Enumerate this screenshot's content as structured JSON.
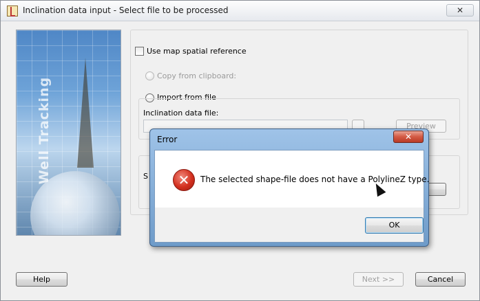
{
  "window": {
    "title": "Inclination data input - Select file to be processed",
    "close_glyph": "✕"
  },
  "sidebar": {
    "brand_text": "Well Tracking"
  },
  "options": {
    "use_map_spatial_reference": "Use map spatial reference",
    "copy_from_clipboard": "Copy from clipboard:",
    "import_from_file": "Import from file",
    "inclination_data_file_label": "Inclination data file:",
    "preview_label": "Preview",
    "partial_label": "S"
  },
  "footer": {
    "help_label": "Help",
    "next_label": "Next >>",
    "cancel_label": "Cancel"
  },
  "error_dialog": {
    "title": "Error",
    "close_glyph": "✕",
    "message": "The selected shape-file does not have a PolylineZ type.",
    "ok_label": "OK",
    "icon_glyph": "✕"
  },
  "colors": {
    "dialog_frame": "#6e9bc9",
    "close_red": "#d35a44",
    "error_red": "#d3301f"
  }
}
